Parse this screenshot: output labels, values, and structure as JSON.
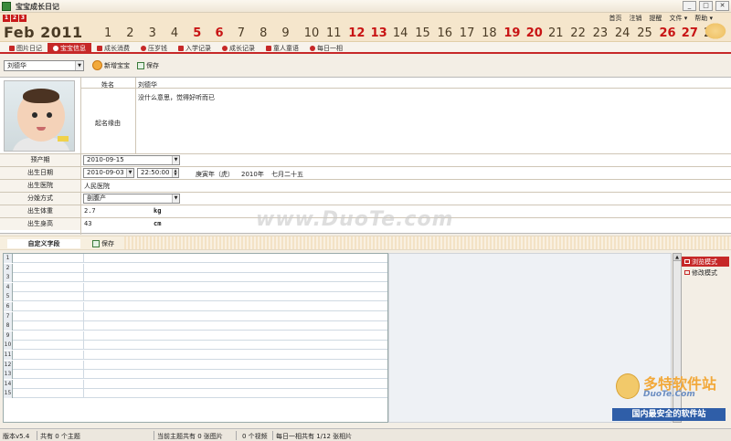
{
  "window": {
    "title": "宝宝成长日记",
    "controls": [
      "_",
      "□",
      "✕"
    ]
  },
  "page_tabs": [
    "1",
    "2",
    "3"
  ],
  "calendar": {
    "month": "Feb 2011",
    "days": [
      "1",
      "2",
      "3",
      "4",
      "5",
      "6",
      "7",
      "8",
      "9",
      "10",
      "11",
      "12",
      "13",
      "14",
      "15",
      "16",
      "17",
      "18",
      "19",
      "20",
      "21",
      "22",
      "23",
      "24",
      "25",
      "26",
      "27",
      "28"
    ],
    "highlighted": [
      "5",
      "6",
      "12",
      "13",
      "19",
      "20",
      "26",
      "27"
    ]
  },
  "topnav": [
    "首页",
    "注销",
    "提醒",
    "文件 ▾",
    "帮助 ▾"
  ],
  "tabs": [
    {
      "label": "图片日记",
      "icon": "photo-icon"
    },
    {
      "label": "宝宝信息",
      "icon": "info-icon",
      "active": true
    },
    {
      "label": "成长消费",
      "icon": "coin-icon"
    },
    {
      "label": "压岁钱",
      "icon": "money-icon"
    },
    {
      "label": "入学记录",
      "icon": "school-icon"
    },
    {
      "label": "成长记录",
      "icon": "growth-icon"
    },
    {
      "label": "童人童语",
      "icon": "speech-icon"
    },
    {
      "label": "每日一相",
      "icon": "camera-icon"
    }
  ],
  "toolbar": {
    "baby_select": "刘德华",
    "add_label": "新增宝宝",
    "save_label": "保存"
  },
  "profile": {
    "name_label": "姓名",
    "name_value": "刘德华",
    "reason_label": "起名缘由",
    "reason_value": "没什么意思，觉得好听而已"
  },
  "fields": {
    "due_label": "预产期",
    "due_value": "2010-09-15",
    "birth_label": "出生日期",
    "birth_date": "2010-09-03",
    "birth_time": "22:50:00",
    "zodiac": "庚寅年（虎）",
    "year": "2010年",
    "lunar": "七月二十五",
    "hospital_label": "出生医院",
    "hospital_value": "人民医院",
    "delivery_label": "分娩方式",
    "delivery_value": "剖腹产",
    "weight_label": "出生体重",
    "weight_value": "2.7",
    "weight_unit": "kg",
    "height_label": "出生身高",
    "height_value": "43",
    "height_unit": "cm"
  },
  "watermark": "www.DuoTe.com",
  "custom": {
    "title": "自定义字段",
    "save_label": "保存",
    "rows": [
      "1",
      "2",
      "3",
      "4",
      "5",
      "6",
      "7",
      "8",
      "9",
      "10",
      "11",
      "12",
      "13",
      "14",
      "15"
    ]
  },
  "modes": {
    "browse": "浏览模式",
    "edit": "修改模式"
  },
  "brand": {
    "line1": "多特软件站",
    "line2": "DuoTe.Com",
    "line3": "国内最安全的软件站"
  },
  "status": {
    "version": "版本v5.4",
    "topics": "共有  0 个主题",
    "photos": "当前主题共有 0 张图片",
    "videos": "0 个视频",
    "daily": "每日一相共有 1/12 张相片"
  }
}
